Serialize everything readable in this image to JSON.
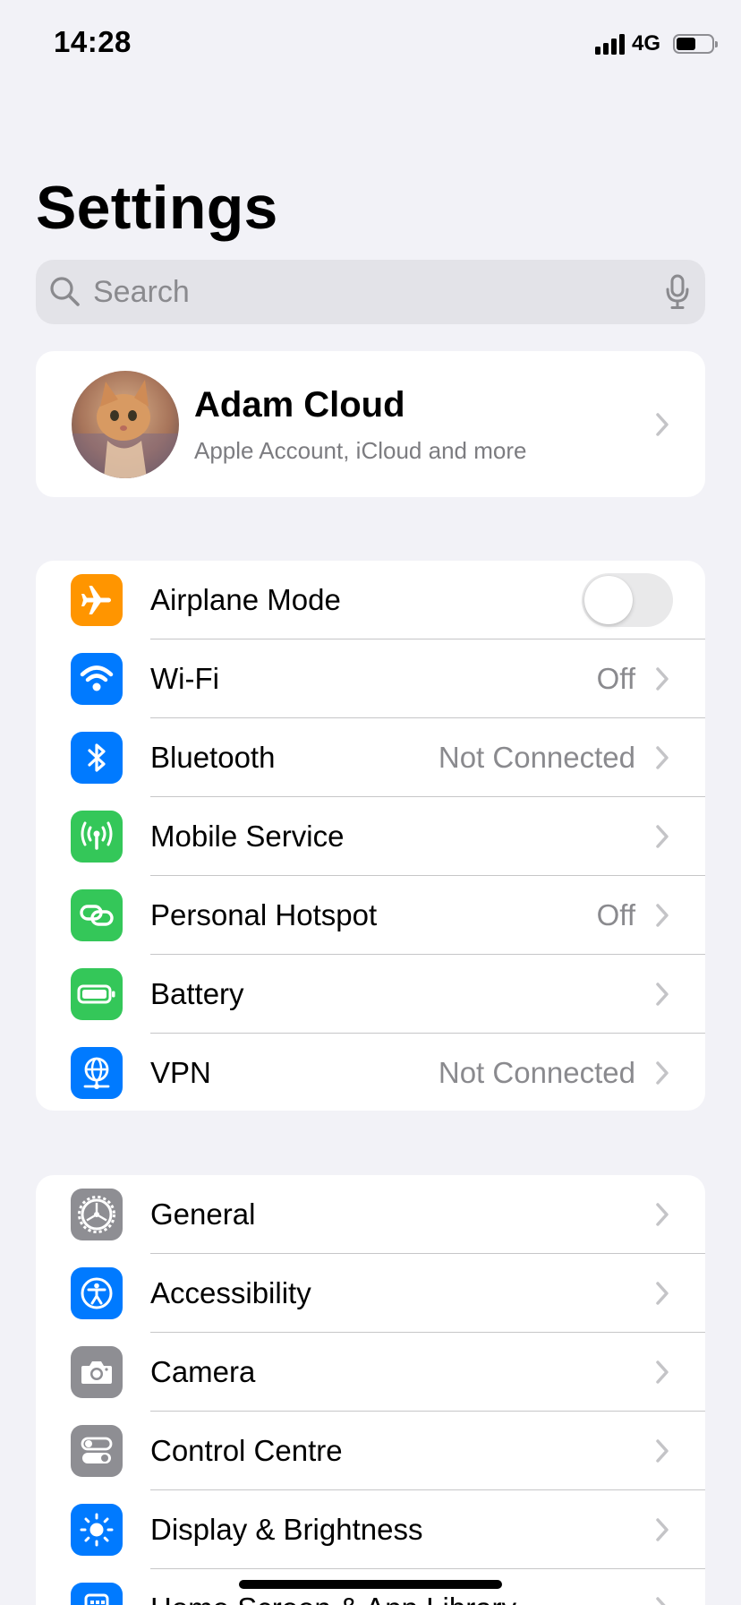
{
  "status_bar": {
    "time": "14:28",
    "network": "4G",
    "signal_bars": 4,
    "battery_level": 0.55
  },
  "page_title": "Settings",
  "search": {
    "placeholder": "Search"
  },
  "account": {
    "name": "Adam Cloud",
    "subtitle": "Apple Account, iCloud and more"
  },
  "groups": [
    {
      "items": [
        {
          "label": "Airplane Mode",
          "icon": "airplane-icon",
          "color": "#ff9500",
          "value": "",
          "toggle": false
        },
        {
          "label": "Wi-Fi",
          "icon": "wifi-icon",
          "color": "#007aff",
          "value": "Off"
        },
        {
          "label": "Bluetooth",
          "icon": "bluetooth-icon",
          "color": "#007aff",
          "value": "Not Connected"
        },
        {
          "label": "Mobile Service",
          "icon": "antenna-icon",
          "color": "#34c759",
          "value": ""
        },
        {
          "label": "Personal Hotspot",
          "icon": "hotspot-link-icon",
          "color": "#34c759",
          "value": "Off"
        },
        {
          "label": "Battery",
          "icon": "battery-icon",
          "color": "#34c759",
          "value": ""
        },
        {
          "label": "VPN",
          "icon": "globe-network-icon",
          "color": "#007aff",
          "value": "Not Connected"
        }
      ]
    },
    {
      "items": [
        {
          "label": "General",
          "icon": "gear-icon",
          "color": "#8e8e93",
          "value": ""
        },
        {
          "label": "Accessibility",
          "icon": "accessibility-icon",
          "color": "#007aff",
          "value": ""
        },
        {
          "label": "Camera",
          "icon": "camera-icon",
          "color": "#8e8e93",
          "value": ""
        },
        {
          "label": "Control Centre",
          "icon": "control-centre-icon",
          "color": "#8e8e93",
          "value": ""
        },
        {
          "label": "Display & Brightness",
          "icon": "sun-icon",
          "color": "#007aff",
          "value": ""
        },
        {
          "label": "Home Screen & App Library",
          "icon": "home-grid-icon",
          "color": "#007aff",
          "value": ""
        }
      ]
    }
  ]
}
